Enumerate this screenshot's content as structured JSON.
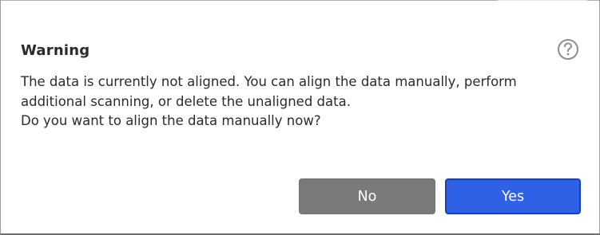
{
  "dialog": {
    "title": "Warning",
    "help_icon": "question-mark-icon",
    "message_lines": [
      "The data is currently not aligned. You can align the data manually, perform",
      "additional scanning, or delete the unaligned data.",
      "Do you want to align the data manually now?"
    ],
    "buttons": {
      "no_label": "No",
      "yes_label": "Yes"
    }
  },
  "colors": {
    "no_button": "#7a7a7a",
    "yes_button": "#2f61e6",
    "yes_border": "#1b3fae",
    "help_icon": "#8e8e8e"
  }
}
